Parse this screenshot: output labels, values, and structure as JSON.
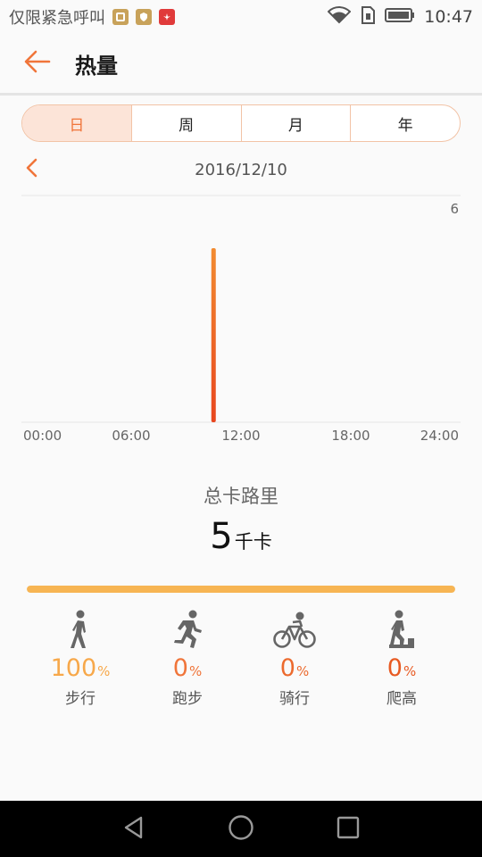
{
  "status_bar": {
    "carrier": "仅限紧急呼叫",
    "time": "10:47"
  },
  "header": {
    "title": "热量"
  },
  "tabs": [
    {
      "label": "日",
      "active": true
    },
    {
      "label": "周",
      "active": false
    },
    {
      "label": "月",
      "active": false
    },
    {
      "label": "年",
      "active": false
    }
  ],
  "date": "2016/12/10",
  "chart_data": {
    "type": "bar",
    "x_ticks": [
      "00:00",
      "06:00",
      "12:00",
      "18:00",
      "24:00"
    ],
    "y_max_label": "6",
    "ylim": [
      0,
      6
    ],
    "xlim_hours": [
      0,
      24
    ],
    "bars": [
      {
        "hour": 10.5,
        "value": 5
      }
    ],
    "colors": {
      "bar_top": "#f28b30",
      "bar_bottom": "#e8461e",
      "grid": "#e6e6e6"
    }
  },
  "total": {
    "label": "总卡路里",
    "value": "5",
    "unit": "千卡",
    "progress_fraction": 1.0
  },
  "activities": [
    {
      "name": "步行",
      "percent": "100",
      "symbol": "%",
      "color": "#f7a84a",
      "icon": "walk-icon"
    },
    {
      "name": "跑步",
      "percent": "0",
      "symbol": "%",
      "color": "#f0753a",
      "icon": "run-icon"
    },
    {
      "name": "骑行",
      "percent": "0",
      "symbol": "%",
      "color": "#ec6a2e",
      "icon": "bike-icon"
    },
    {
      "name": "爬高",
      "percent": "0",
      "symbol": "%",
      "color": "#e85a22",
      "icon": "climb-icon"
    }
  ],
  "colors": {
    "accent": "#f0753a",
    "progress": "#f7b553"
  }
}
